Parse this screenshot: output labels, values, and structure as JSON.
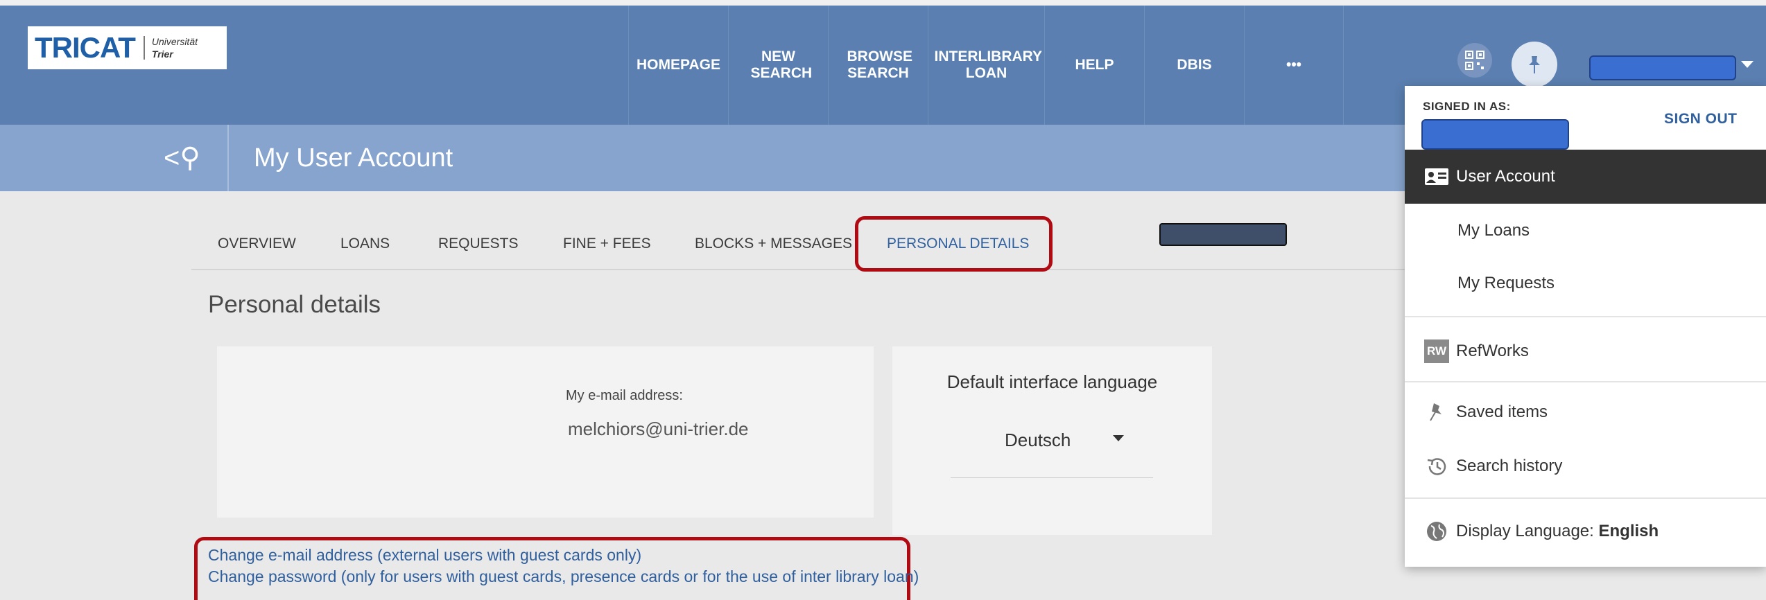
{
  "header": {
    "logo": {
      "word": "TRICAT",
      "uni_line1": "Universität",
      "uni_line2": "Trier"
    },
    "nav": [
      {
        "label": "HOMEPAGE",
        "width": 144
      },
      {
        "label": "NEW SEARCH",
        "width": 144
      },
      {
        "label": "BROWSE SEARCH",
        "width": 144
      },
      {
        "label": "INTERLIBRARY LOAN",
        "width": 168
      },
      {
        "label": "HELP",
        "width": 144
      },
      {
        "label": "DBIS",
        "width": 144
      },
      {
        "label": "•••",
        "width": 144
      }
    ]
  },
  "subheader": {
    "title": "My User Account",
    "back_search_symbol": "<⚲"
  },
  "tabs": {
    "overview": "OVERVIEW",
    "loans": "LOANS",
    "requests": "REQUESTS",
    "fines": "FINE + FEES",
    "blocks": "BLOCKS + MESSAGES",
    "personal": "PERSONAL DETAILS",
    "active": "PERSONAL DETAILS"
  },
  "main": {
    "section_title": "Personal details",
    "email_label": "My e-mail address:",
    "email_value": "melchiors@uni-trier.de",
    "language_title": "Default interface language",
    "language_value": "Deutsch",
    "link_change_email": "Change e-mail address (external users with guest cards only)",
    "link_change_password": "Change password (only for users with guest cards, presence cards or for the use of inter library loan)"
  },
  "dropdown": {
    "signed_in_label": "SIGNED IN AS:",
    "sign_out": "SIGN OUT",
    "user_account": "User Account",
    "my_loans": "My Loans",
    "my_requests": "My Requests",
    "refworks": "RefWorks",
    "refworks_badge": "RW",
    "saved_items": "Saved items",
    "search_history": "Search history",
    "display_language_label": "Display Language: ",
    "display_language_value": "English"
  },
  "colors": {
    "nav_bg": "#5a7fb0",
    "subheader_bg": "#86a4cd",
    "highlight_red": "#b00b12",
    "link_blue": "#2f5f9d",
    "redaction_blue": "#3a6fd1"
  }
}
